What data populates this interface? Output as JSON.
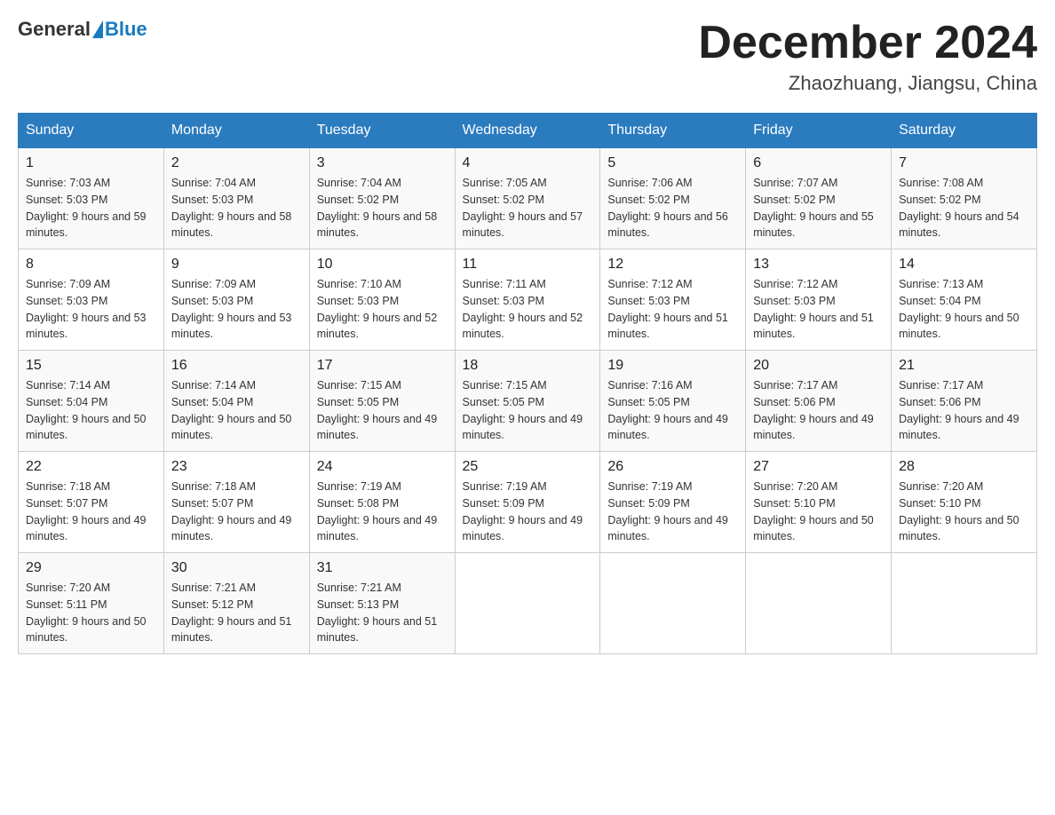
{
  "header": {
    "logo_general": "General",
    "logo_blue": "Blue",
    "month_year": "December 2024",
    "location": "Zhaozhuang, Jiangsu, China"
  },
  "weekdays": [
    "Sunday",
    "Monday",
    "Tuesday",
    "Wednesday",
    "Thursday",
    "Friday",
    "Saturday"
  ],
  "weeks": [
    [
      {
        "day": "1",
        "sunrise": "7:03 AM",
        "sunset": "5:03 PM",
        "daylight": "9 hours and 59 minutes."
      },
      {
        "day": "2",
        "sunrise": "7:04 AM",
        "sunset": "5:03 PM",
        "daylight": "9 hours and 58 minutes."
      },
      {
        "day": "3",
        "sunrise": "7:04 AM",
        "sunset": "5:02 PM",
        "daylight": "9 hours and 58 minutes."
      },
      {
        "day": "4",
        "sunrise": "7:05 AM",
        "sunset": "5:02 PM",
        "daylight": "9 hours and 57 minutes."
      },
      {
        "day": "5",
        "sunrise": "7:06 AM",
        "sunset": "5:02 PM",
        "daylight": "9 hours and 56 minutes."
      },
      {
        "day": "6",
        "sunrise": "7:07 AM",
        "sunset": "5:02 PM",
        "daylight": "9 hours and 55 minutes."
      },
      {
        "day": "7",
        "sunrise": "7:08 AM",
        "sunset": "5:02 PM",
        "daylight": "9 hours and 54 minutes."
      }
    ],
    [
      {
        "day": "8",
        "sunrise": "7:09 AM",
        "sunset": "5:03 PM",
        "daylight": "9 hours and 53 minutes."
      },
      {
        "day": "9",
        "sunrise": "7:09 AM",
        "sunset": "5:03 PM",
        "daylight": "9 hours and 53 minutes."
      },
      {
        "day": "10",
        "sunrise": "7:10 AM",
        "sunset": "5:03 PM",
        "daylight": "9 hours and 52 minutes."
      },
      {
        "day": "11",
        "sunrise": "7:11 AM",
        "sunset": "5:03 PM",
        "daylight": "9 hours and 52 minutes."
      },
      {
        "day": "12",
        "sunrise": "7:12 AM",
        "sunset": "5:03 PM",
        "daylight": "9 hours and 51 minutes."
      },
      {
        "day": "13",
        "sunrise": "7:12 AM",
        "sunset": "5:03 PM",
        "daylight": "9 hours and 51 minutes."
      },
      {
        "day": "14",
        "sunrise": "7:13 AM",
        "sunset": "5:04 PM",
        "daylight": "9 hours and 50 minutes."
      }
    ],
    [
      {
        "day": "15",
        "sunrise": "7:14 AM",
        "sunset": "5:04 PM",
        "daylight": "9 hours and 50 minutes."
      },
      {
        "day": "16",
        "sunrise": "7:14 AM",
        "sunset": "5:04 PM",
        "daylight": "9 hours and 50 minutes."
      },
      {
        "day": "17",
        "sunrise": "7:15 AM",
        "sunset": "5:05 PM",
        "daylight": "9 hours and 49 minutes."
      },
      {
        "day": "18",
        "sunrise": "7:15 AM",
        "sunset": "5:05 PM",
        "daylight": "9 hours and 49 minutes."
      },
      {
        "day": "19",
        "sunrise": "7:16 AM",
        "sunset": "5:05 PM",
        "daylight": "9 hours and 49 minutes."
      },
      {
        "day": "20",
        "sunrise": "7:17 AM",
        "sunset": "5:06 PM",
        "daylight": "9 hours and 49 minutes."
      },
      {
        "day": "21",
        "sunrise": "7:17 AM",
        "sunset": "5:06 PM",
        "daylight": "9 hours and 49 minutes."
      }
    ],
    [
      {
        "day": "22",
        "sunrise": "7:18 AM",
        "sunset": "5:07 PM",
        "daylight": "9 hours and 49 minutes."
      },
      {
        "day": "23",
        "sunrise": "7:18 AM",
        "sunset": "5:07 PM",
        "daylight": "9 hours and 49 minutes."
      },
      {
        "day": "24",
        "sunrise": "7:19 AM",
        "sunset": "5:08 PM",
        "daylight": "9 hours and 49 minutes."
      },
      {
        "day": "25",
        "sunrise": "7:19 AM",
        "sunset": "5:09 PM",
        "daylight": "9 hours and 49 minutes."
      },
      {
        "day": "26",
        "sunrise": "7:19 AM",
        "sunset": "5:09 PM",
        "daylight": "9 hours and 49 minutes."
      },
      {
        "day": "27",
        "sunrise": "7:20 AM",
        "sunset": "5:10 PM",
        "daylight": "9 hours and 50 minutes."
      },
      {
        "day": "28",
        "sunrise": "7:20 AM",
        "sunset": "5:10 PM",
        "daylight": "9 hours and 50 minutes."
      }
    ],
    [
      {
        "day": "29",
        "sunrise": "7:20 AM",
        "sunset": "5:11 PM",
        "daylight": "9 hours and 50 minutes."
      },
      {
        "day": "30",
        "sunrise": "7:21 AM",
        "sunset": "5:12 PM",
        "daylight": "9 hours and 51 minutes."
      },
      {
        "day": "31",
        "sunrise": "7:21 AM",
        "sunset": "5:13 PM",
        "daylight": "9 hours and 51 minutes."
      },
      null,
      null,
      null,
      null
    ]
  ]
}
